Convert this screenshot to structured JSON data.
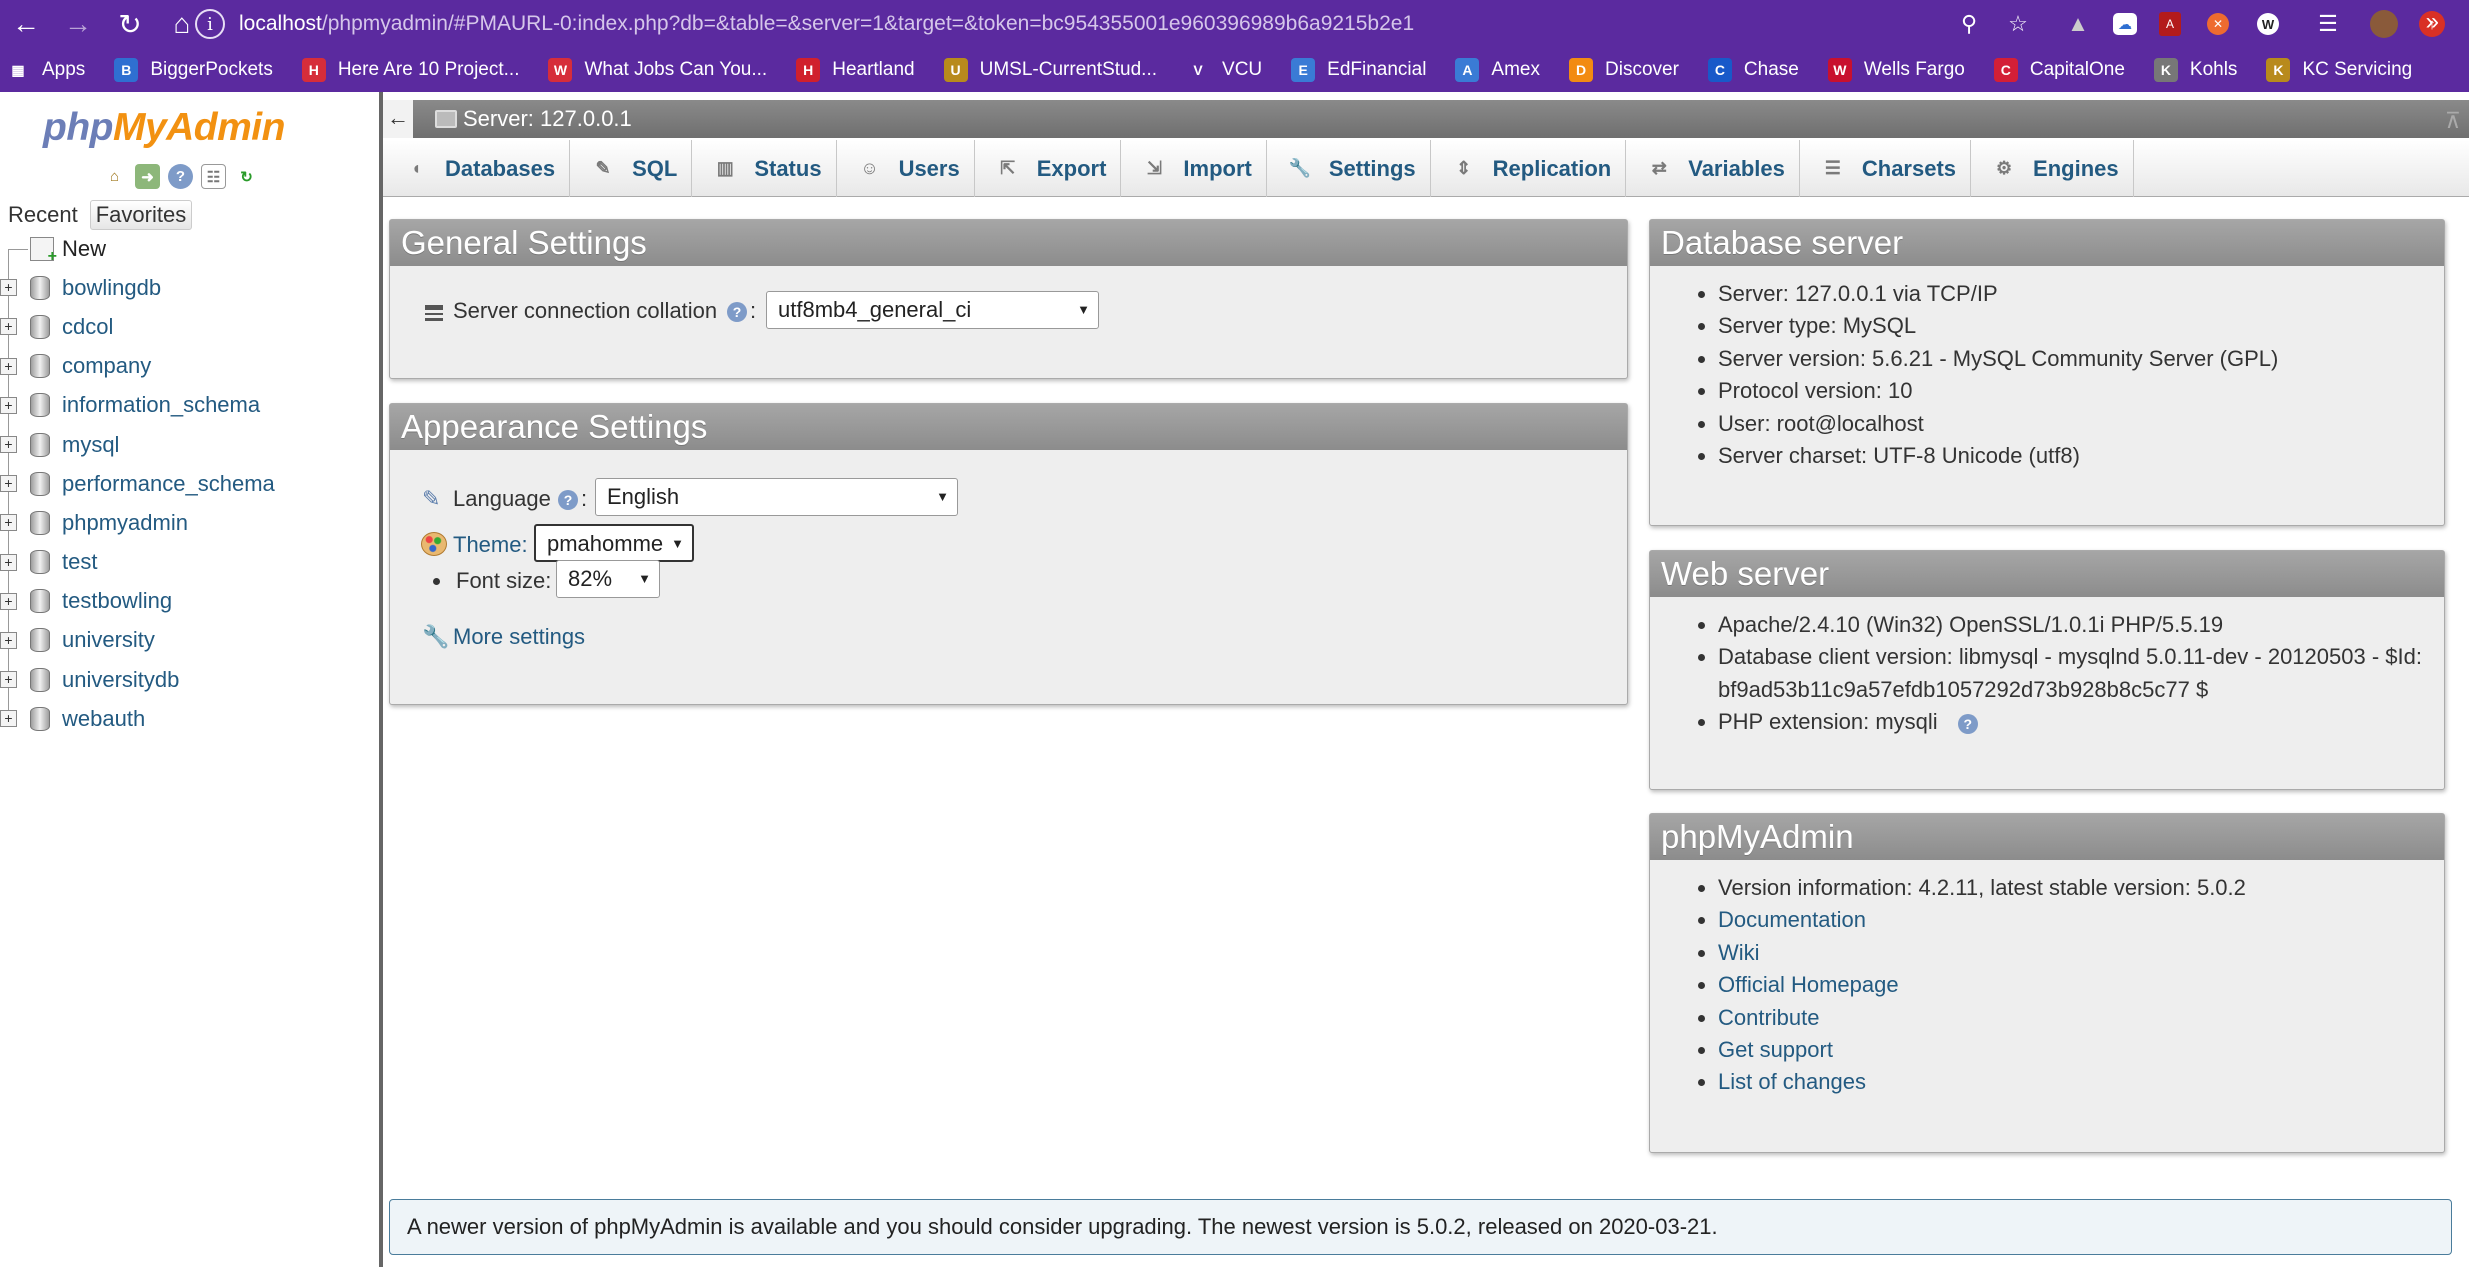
{
  "browser": {
    "url_host": "localhost",
    "url_path": "/phpmyadmin/#PMAURL-0:index.php?db=&table=&server=1&target=&token=bc954355001e960396989b6a9215b2e1",
    "bookmarks": [
      {
        "label": "Apps",
        "icon": "apps-grid-icon",
        "color": "#5b2a9f"
      },
      {
        "label": "BiggerPockets",
        "icon": "biggerpockets-icon",
        "color": "#2f6fd1"
      },
      {
        "label": "Here Are 10 Project...",
        "icon": "article-icon",
        "color": "#d62d3a"
      },
      {
        "label": "What Jobs Can You...",
        "icon": "article-icon",
        "color": "#d62d3a"
      },
      {
        "label": "Heartland",
        "icon": "heartland-icon",
        "color": "#d0202d"
      },
      {
        "label": "UMSL-CurrentStud...",
        "icon": "umsl-icon",
        "color": "#b88a1c"
      },
      {
        "label": "VCU",
        "icon": "vcu-icon",
        "color": "#5b2a9f"
      },
      {
        "label": "EdFinancial",
        "icon": "edfinancial-icon",
        "color": "#3a7bd5"
      },
      {
        "label": "Amex",
        "icon": "amex-icon",
        "color": "#3a7bd5"
      },
      {
        "label": "Discover",
        "icon": "discover-icon",
        "color": "#f28b12"
      },
      {
        "label": "Chase",
        "icon": "chase-icon",
        "color": "#1859c9"
      },
      {
        "label": "Wells Fargo",
        "icon": "wellsfargo-icon",
        "color": "#c8102e"
      },
      {
        "label": "CapitalOne",
        "icon": "capitalone-icon",
        "color": "#d31f37"
      },
      {
        "label": "Kohls",
        "icon": "globe-icon",
        "color": "#777777"
      },
      {
        "label": "KC Servicing",
        "icon": "kc-icon",
        "color": "#b88a1c"
      }
    ],
    "more": "»"
  },
  "nav": {
    "logo_php": "php",
    "logo_myadmin": "MyAdmin",
    "tabs": [
      "Recent",
      "Favorites"
    ],
    "new_label": "New",
    "databases": [
      "bowlingdb",
      "cdcol",
      "company",
      "information_schema",
      "mysql",
      "performance_schema",
      "phpmyadmin",
      "test",
      "testbowling",
      "university",
      "universitydb",
      "webauth"
    ]
  },
  "server_bar": {
    "title": "Server: 127.0.0.1"
  },
  "tabs": [
    {
      "label": "Databases",
      "icon": "database-icon"
    },
    {
      "label": "SQL",
      "icon": "sql-icon"
    },
    {
      "label": "Status",
      "icon": "status-chart-icon"
    },
    {
      "label": "Users",
      "icon": "users-icon"
    },
    {
      "label": "Export",
      "icon": "export-icon"
    },
    {
      "label": "Import",
      "icon": "import-icon"
    },
    {
      "label": "Settings",
      "icon": "wrench-icon"
    },
    {
      "label": "Replication",
      "icon": "replication-icon"
    },
    {
      "label": "Variables",
      "icon": "variables-icon"
    },
    {
      "label": "Charsets",
      "icon": "charsets-icon"
    },
    {
      "label": "Engines",
      "icon": "engines-icon"
    }
  ],
  "general_settings": {
    "title": "General Settings",
    "collation_label": "Server connection collation",
    "collation_value": "utf8mb4_general_ci"
  },
  "appearance_settings": {
    "title": "Appearance Settings",
    "language_label": "Language",
    "language_value": "English",
    "theme_label": "Theme:",
    "theme_value": "pmahomme",
    "font_size_label": "Font size:",
    "font_size_value": "82%",
    "more_settings": "More settings"
  },
  "database_server": {
    "title": "Database server",
    "items": [
      "Server: 127.0.0.1 via TCP/IP",
      "Server type: MySQL",
      "Server version: 5.6.21 - MySQL Community Server (GPL)",
      "Protocol version: 10",
      "User: root@localhost",
      "Server charset: UTF-8 Unicode (utf8)"
    ]
  },
  "web_server": {
    "title": "Web server",
    "apache": "Apache/2.4.10 (Win32) OpenSSL/1.0.1i PHP/5.5.19",
    "client_line1": "Database client version: libmysql - mysqlnd 5.0.11-dev - 20120503 - $Id:",
    "client_line2": "bf9ad53b11c9a57efdb1057292d73b928b8c5c77 $",
    "php_ext": "PHP extension: mysqli"
  },
  "phpmyadmin_panel": {
    "title": "phpMyAdmin",
    "version": "Version information: 4.2.11, latest stable version: 5.0.2",
    "links": [
      "Documentation",
      "Wiki",
      "Official Homepage",
      "Contribute",
      "Get support",
      "List of changes"
    ]
  },
  "notice": "A newer version of phpMyAdmin is available and you should consider upgrading. The newest version is 5.0.2, released on 2020-03-21."
}
